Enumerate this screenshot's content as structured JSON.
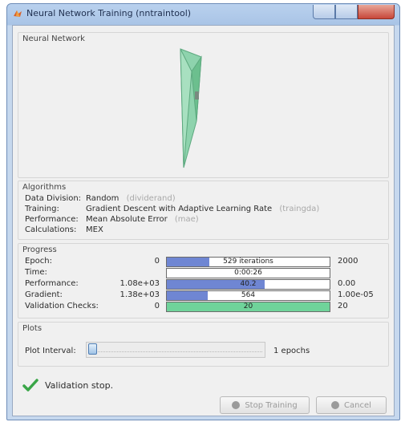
{
  "window": {
    "title": "Neural Network Training (nntraintool)"
  },
  "network_panel": {
    "title": "Neural Network"
  },
  "algorithms": {
    "title": "Algorithms",
    "rows": [
      {
        "label": "Data Division:",
        "value": "Random",
        "hint": "(dividerand)"
      },
      {
        "label": "Training:",
        "value": "Gradient Descent with Adaptive Learning Rate",
        "hint": "(traingda)"
      },
      {
        "label": "Performance:",
        "value": "Mean Absolute Error",
        "hint": "(mae)"
      },
      {
        "label": "Calculations:",
        "value": "MEX",
        "hint": ""
      }
    ]
  },
  "progress": {
    "title": "Progress",
    "rows": [
      {
        "label": "Epoch:",
        "start": "0",
        "bar_text": "529 iterations",
        "end": "2000",
        "fraction": 0.26,
        "color": "#6f86d3"
      },
      {
        "label": "Time:",
        "start": "",
        "bar_text": "0:00:26",
        "end": "",
        "fraction": 0,
        "color": "#6f86d3"
      },
      {
        "label": "Performance:",
        "start": "1.08e+03",
        "bar_text": "40.2",
        "end": "0.00",
        "fraction": 0.6,
        "color": "#6f86d3"
      },
      {
        "label": "Gradient:",
        "start": "1.38e+03",
        "bar_text": "564",
        "end": "1.00e-05",
        "fraction": 0.25,
        "color": "#6f86d3"
      },
      {
        "label": "Validation Checks:",
        "start": "0",
        "bar_text": "20",
        "end": "20",
        "fraction": 1.0,
        "color": "#6fd39a"
      }
    ]
  },
  "plots": {
    "title": "Plots",
    "interval_label": "Plot Interval:",
    "interval_value": "1 epochs",
    "slider_fraction": 0.0
  },
  "status": {
    "text": "Validation stop.",
    "color": "#3aa648"
  },
  "buttons": {
    "stop_label": "Stop Training",
    "cancel_label": "Cancel"
  }
}
